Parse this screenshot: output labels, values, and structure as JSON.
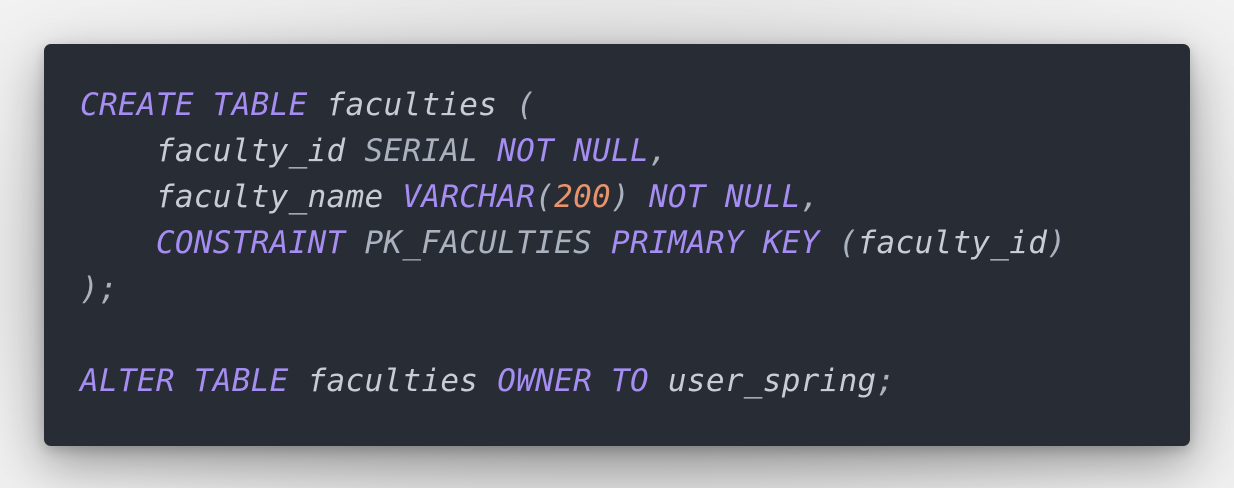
{
  "editor": {
    "lines": [
      [
        {
          "t": "CREATE TABLE",
          "k": "keyword"
        },
        {
          "t": " ",
          "k": "plain"
        },
        {
          "t": "faculties",
          "k": "ident"
        },
        {
          "t": " (",
          "k": "punct"
        }
      ],
      [
        {
          "t": "    ",
          "k": "plain"
        },
        {
          "t": "faculty_id",
          "k": "ident"
        },
        {
          "t": " SERIAL ",
          "k": "plain"
        },
        {
          "t": "NOT NULL",
          "k": "keyword"
        },
        {
          "t": ",",
          "k": "punct"
        }
      ],
      [
        {
          "t": "    ",
          "k": "plain"
        },
        {
          "t": "faculty_name",
          "k": "ident"
        },
        {
          "t": " ",
          "k": "plain"
        },
        {
          "t": "VARCHAR",
          "k": "keyword"
        },
        {
          "t": "(",
          "k": "punct"
        },
        {
          "t": "200",
          "k": "number"
        },
        {
          "t": ") ",
          "k": "punct"
        },
        {
          "t": "NOT NULL",
          "k": "keyword"
        },
        {
          "t": ",",
          "k": "punct"
        }
      ],
      [
        {
          "t": "    ",
          "k": "plain"
        },
        {
          "t": "CONSTRAINT",
          "k": "keyword"
        },
        {
          "t": " PK_FACULTIES ",
          "k": "plain"
        },
        {
          "t": "PRIMARY KEY",
          "k": "keyword"
        },
        {
          "t": " (",
          "k": "punct"
        },
        {
          "t": "faculty_id",
          "k": "ident"
        },
        {
          "t": ")",
          "k": "punct"
        }
      ],
      [
        {
          "t": ");",
          "k": "punct"
        }
      ],
      [],
      [
        {
          "t": "ALTER TABLE",
          "k": "keyword"
        },
        {
          "t": " ",
          "k": "plain"
        },
        {
          "t": "faculties",
          "k": "ident"
        },
        {
          "t": " ",
          "k": "plain"
        },
        {
          "t": "OWNER TO",
          "k": "keyword"
        },
        {
          "t": " ",
          "k": "plain"
        },
        {
          "t": "user_spring",
          "k": "ident"
        },
        {
          "t": ";",
          "k": "punct"
        }
      ]
    ]
  }
}
